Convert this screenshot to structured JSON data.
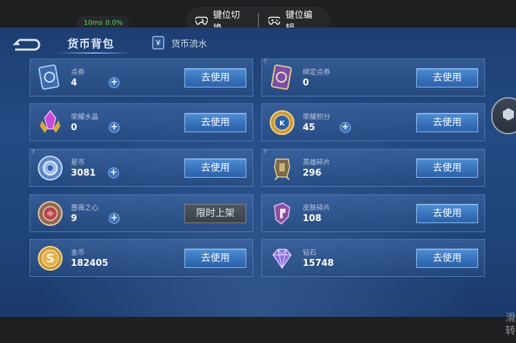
{
  "overlay": {
    "latency_ms": "10ms",
    "loss": "0.0%",
    "key_switch_label": "键位切换",
    "key_edit_label": "键位编辑"
  },
  "header": {
    "title": "货币背包",
    "flow_tab": "货币流水"
  },
  "currencies": [
    {
      "label": "点券",
      "value": "4",
      "plus": true,
      "button": "去使用",
      "icon": "voucher-card-icon"
    },
    {
      "label": "绑定点券",
      "value": "0",
      "plus": false,
      "button": "去使用",
      "icon": "bound-voucher-card-icon"
    },
    {
      "label": "荣耀水晶",
      "value": "0",
      "plus": true,
      "button": "去使用",
      "icon": "glory-crystal-icon"
    },
    {
      "label": "荣耀积分",
      "value": "45",
      "plus": true,
      "button": "去使用",
      "icon": "glory-points-coin-icon"
    },
    {
      "label": "星币",
      "value": "3081",
      "plus": true,
      "button": "去使用",
      "icon": "star-coin-icon"
    },
    {
      "label": "英雄碎片",
      "value": "296",
      "plus": false,
      "button": "去使用",
      "icon": "hero-fragment-icon"
    },
    {
      "label": "蔷薇之心",
      "value": "9",
      "plus": true,
      "button": "限时上架",
      "icon": "rose-heart-icon"
    },
    {
      "label": "皮肤碎片",
      "value": "108",
      "plus": false,
      "button": "去使用",
      "icon": "skin-fragment-icon"
    },
    {
      "label": "金币",
      "value": "182405",
      "plus": false,
      "button": "去使用",
      "icon": "gold-coin-icon"
    },
    {
      "label": "钻石",
      "value": "15748",
      "plus": false,
      "button": "去使用",
      "icon": "diamond-icon"
    }
  ],
  "help_mark": "?",
  "plus_symbol": "+",
  "bottom_right_text": "滑 转",
  "colors": {
    "background": "#1f4479",
    "button": "#3872bb",
    "button_disabled": "#3a4149",
    "latency_green": "#5fd36b"
  }
}
